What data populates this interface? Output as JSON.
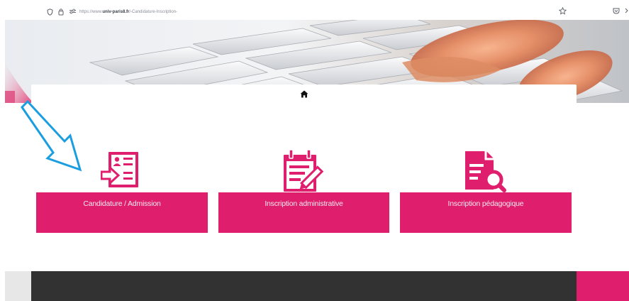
{
  "browser": {
    "url_prefix": "https://www.",
    "url_domain": "univ-paris8.fr",
    "url_path": "/-Candidature-Inscription-",
    "icons": [
      "shield-icon",
      "lock-icon",
      "permissions-icon",
      "bookmark-star-icon",
      "pocket-icon"
    ]
  },
  "card": {
    "home_icon": "home-icon"
  },
  "tiles": [
    {
      "label": "Candidature / Admission",
      "icon": "application-form-icon"
    },
    {
      "label": "Inscription administrative",
      "icon": "calendar-edit-icon"
    },
    {
      "label": "Inscription pédagogique",
      "icon": "document-search-icon"
    }
  ],
  "colors": {
    "brand_pink": "#df1f6d",
    "footer_dark": "#323232",
    "arrow_blue": "#1a9ee0"
  }
}
